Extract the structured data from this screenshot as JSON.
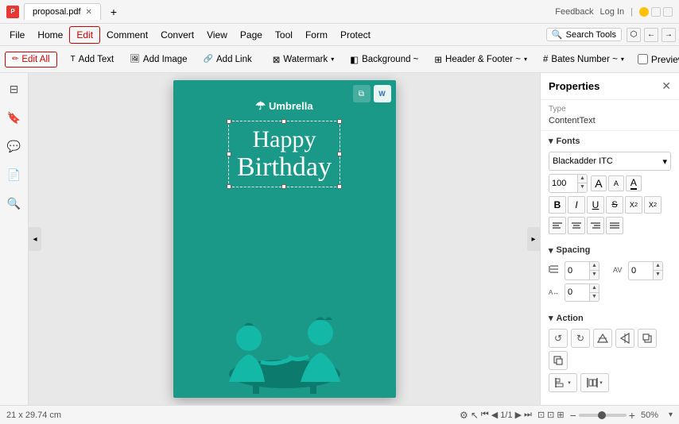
{
  "titlebar": {
    "tab_label": "proposal.pdf",
    "add_tab": "+",
    "feedback": "Feedback",
    "login": "Log In"
  },
  "menubar": {
    "items": [
      "File",
      "Home",
      "Edit",
      "Comment",
      "Convert",
      "View",
      "Page",
      "Tool",
      "Form",
      "Protect"
    ]
  },
  "toolbar": {
    "edit_all": "Edit All",
    "add_text": "Add Text",
    "add_image": "Add Image",
    "add_link": "Add Link",
    "watermark": "Watermark",
    "background": "Background ~",
    "header_footer": "Header & Footer ~",
    "bates_number": "Bates Number ~",
    "preview": "Preview"
  },
  "properties": {
    "title": "Properties",
    "type_label": "Type",
    "type_value": "ContentText",
    "fonts_label": "Fonts",
    "font_name": "Blackadder ITC",
    "font_size": "100",
    "text_color": "#000000",
    "spacing_label": "Spacing",
    "line_spacing_value": "0",
    "char_spacing_value": "0",
    "word_spacing_value": "0",
    "action_label": "Action"
  },
  "page": {
    "umbrella_text": "Umbrella",
    "happy_text": "Happy",
    "birthday_text": "Birthday"
  },
  "statusbar": {
    "dimensions": "21 x 29.74 cm",
    "page_current": "1",
    "page_total": "1",
    "zoom_value": "50%"
  },
  "icons": {
    "chevron_down": "▾",
    "chevron_right": "▸",
    "chevron_left": "◂",
    "arrow_left": "❮",
    "arrow_right": "❯",
    "close": "✕",
    "bold": "B",
    "italic": "I",
    "underline": "U",
    "strikethrough": "S",
    "superscript": "X²",
    "subscript": "X₂",
    "align_left": "≡",
    "align_center": "≡",
    "align_right": "≡",
    "align_justify": "≡",
    "undo": "↺",
    "redo": "↻",
    "rotate": "⟳",
    "flip_h": "↔",
    "flip_v": "↕",
    "bring_front": "⬛",
    "send_back": "⬛",
    "line_spacing": "↕",
    "char_spacing": "↔",
    "word_spacing": "↔",
    "spin_up": "▲",
    "spin_down": "▼",
    "bookmark": "🔖",
    "search": "🔍",
    "comment": "💬",
    "page_thumb": "⊟",
    "nav_first": "⏮",
    "nav_prev": "◀",
    "nav_next": "▶",
    "nav_last": "⏭",
    "fit": "⊡",
    "zoom_minus": "−",
    "zoom_plus": "+",
    "page_select": "⊡"
  }
}
